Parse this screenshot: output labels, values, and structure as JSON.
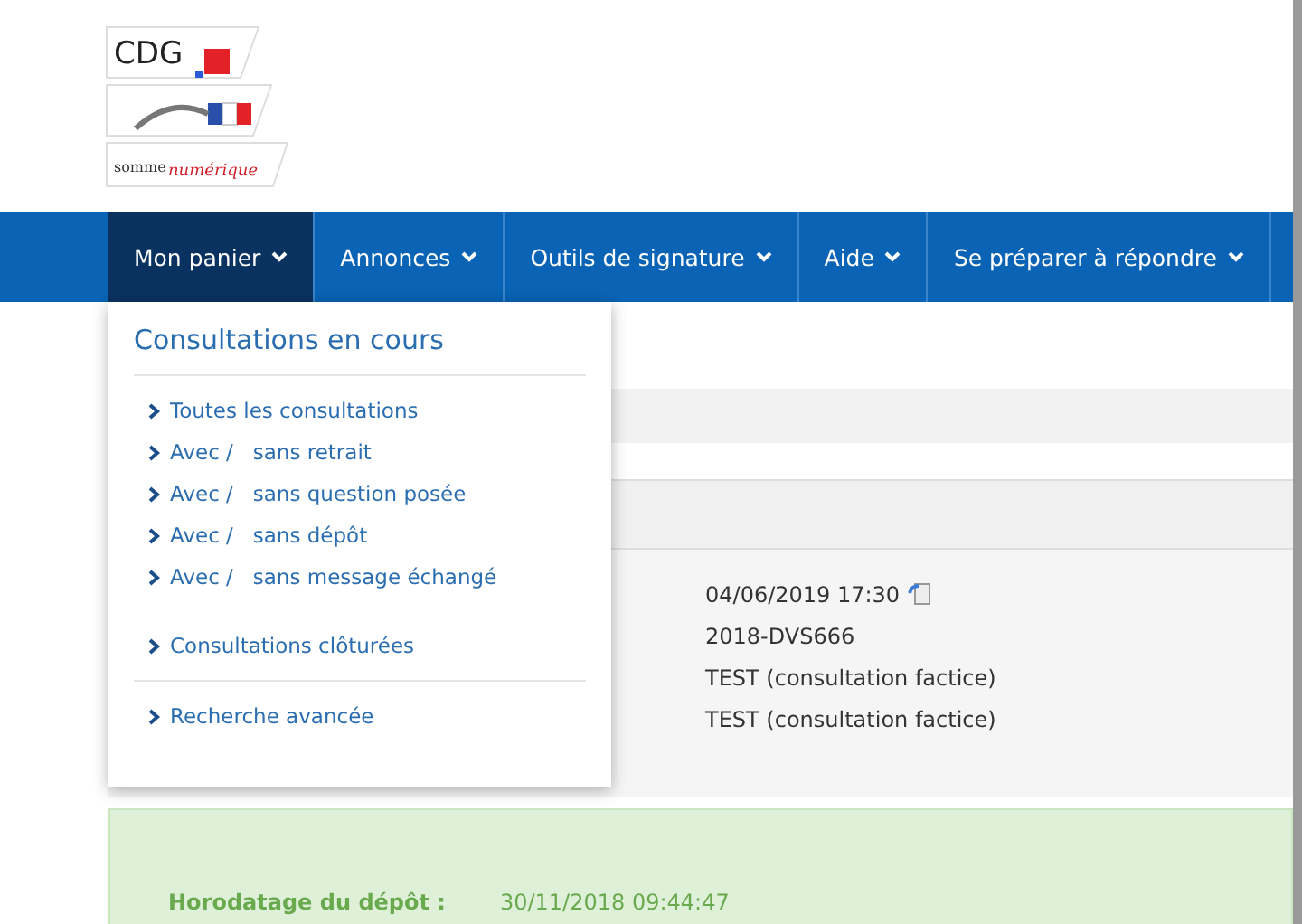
{
  "logo": {
    "top": "CDG",
    "bottom_left": "somme",
    "bottom_right": "numérique"
  },
  "nav": [
    {
      "label": "Mon panier",
      "selected": true
    },
    {
      "label": "Annonces",
      "selected": false
    },
    {
      "label": "Outils de signature",
      "selected": false
    },
    {
      "label": "Aide",
      "selected": false
    },
    {
      "label": "Se préparer à répondre",
      "selected": false
    }
  ],
  "dropdown": {
    "title": "Consultations en cours",
    "groups": [
      [
        "Toutes les consultations",
        "Avec /   sans retrait",
        "Avec /   sans question posée",
        "Avec /   sans dépôt",
        "Avec /   sans message échangé"
      ],
      [
        "Consultations clôturées"
      ],
      [
        "Recherche avancée"
      ]
    ]
  },
  "details": [
    "04/06/2019 17:30",
    "2018-DVS666",
    "TEST (consultation factice)",
    "TEST (consultation factice)"
  ],
  "deposit": {
    "label": "Horodatage du dépôt :",
    "value": "30/11/2018 09:44:47"
  }
}
